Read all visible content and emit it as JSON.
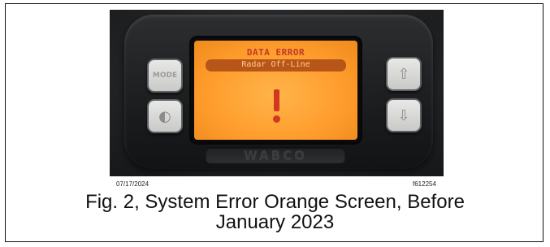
{
  "figure": {
    "date": "07/17/2024",
    "ref_code": "f612254",
    "caption_line1": "Fig. 2, System Error Orange Screen, Before",
    "caption_line2": "January 2023"
  },
  "device": {
    "screen_title": "DATA ERROR",
    "screen_subtitle": "Radar Off-Line",
    "brand": "WABCO",
    "mode_button_label": "MODE",
    "icons": {
      "mode": "mode-icon",
      "brightness": "brightness-icon",
      "up": "up-arrow-icon",
      "down": "down-arrow-icon",
      "alert": "exclamation-icon"
    },
    "screen_color": "#ff9e2e"
  }
}
